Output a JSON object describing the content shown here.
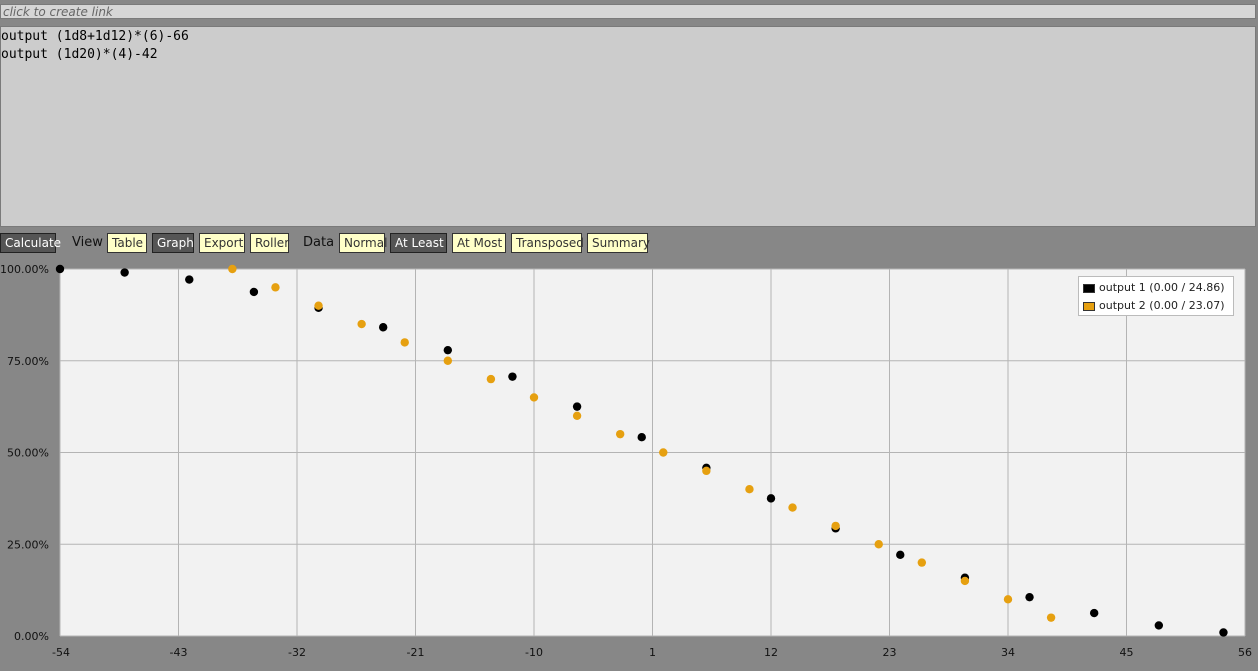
{
  "link_bar": {
    "text": "click to create link"
  },
  "editor": {
    "lines": [
      "output (1d8+1d12)*(6)-66",
      "output (1d20)*(4)-42"
    ]
  },
  "toolbar": {
    "calculate": "Calculate",
    "view_label": "View",
    "view_buttons": [
      "Table",
      "Graph",
      "Export",
      "Roller"
    ],
    "data_label": "Data",
    "data_buttons": [
      "Normal",
      "At Least",
      "At Most",
      "Transposed",
      "Summary"
    ],
    "active_view": "Graph",
    "active_data": "At Least"
  },
  "legend": {
    "items": [
      "output 1 (0.00 / 24.86)",
      "output 2 (0.00 / 23.07)"
    ]
  },
  "colors": {
    "series1": "#000000",
    "series2": "#e6a010",
    "plot_bg": "#f2f2f2",
    "grid": "#b4b4b4",
    "page_bg": "#878787"
  },
  "chart_data": {
    "type": "scatter",
    "x_ticks": [
      "-54",
      "-43",
      "-32",
      "-21",
      "-10",
      "1",
      "12",
      "23",
      "34",
      "45",
      "56"
    ],
    "y_ticks": [
      "0.00%",
      "25.00%",
      "50.00%",
      "75.00%",
      "100.00%"
    ],
    "xlim": [
      -54,
      56
    ],
    "ylim": [
      0,
      100
    ],
    "grid": true,
    "legend_position": "top-right",
    "series": [
      {
        "name": "output 1 (0.00 / 24.86)",
        "x": [
          -54,
          -48,
          -42,
          -36,
          -30,
          -24,
          -18,
          -12,
          -6,
          0,
          6,
          12,
          18,
          24,
          30,
          36,
          42,
          48,
          54
        ],
        "y": [
          100.0,
          99.04,
          97.12,
          93.75,
          89.42,
          84.13,
          77.88,
          70.67,
          62.5,
          54.17,
          45.83,
          37.5,
          29.33,
          22.12,
          15.87,
          10.58,
          6.25,
          2.88,
          0.96
        ]
      },
      {
        "name": "output 2 (0.00 / 23.07)",
        "x": [
          -38,
          -34,
          -30,
          -26,
          -22,
          -18,
          -14,
          -10,
          -6,
          -2,
          2,
          6,
          10,
          14,
          18,
          22,
          26,
          30,
          34,
          38
        ],
        "y": [
          100,
          95,
          90,
          85,
          80,
          75,
          70,
          65,
          60,
          55,
          50,
          45,
          40,
          35,
          30,
          25,
          20,
          15,
          10,
          5
        ]
      }
    ]
  }
}
